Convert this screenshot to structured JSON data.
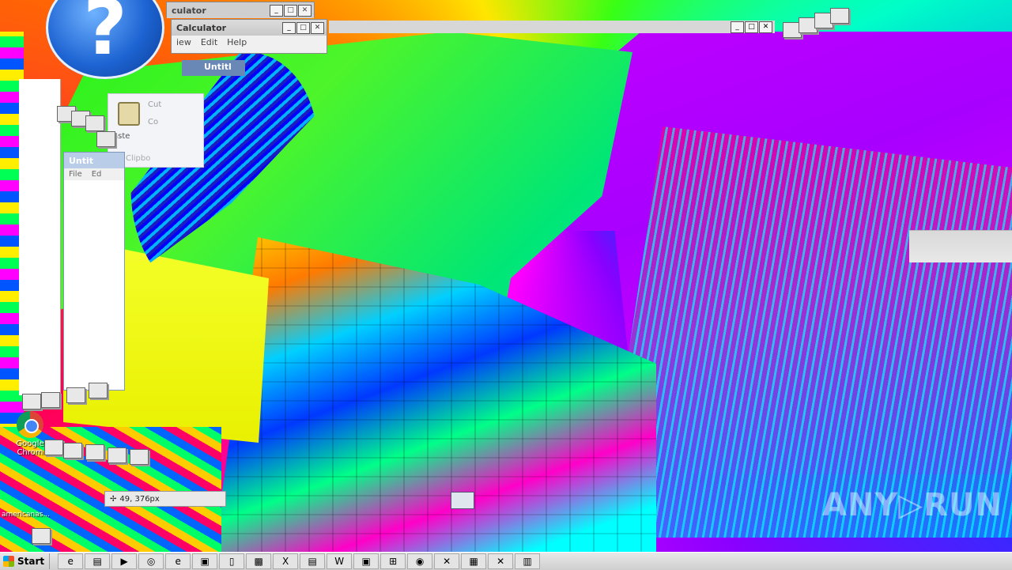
{
  "windows": {
    "calculator_back": {
      "title": "Calculator",
      "visible_title": "culator"
    },
    "calculator_front": {
      "title": "Calculator",
      "menu": [
        "View",
        "Edit",
        "Help"
      ],
      "visible_menu_first": "iew"
    },
    "untitled_top": {
      "title": "Untitled",
      "visible_title": "Untitl"
    },
    "untitled_left": {
      "title": "Untitled",
      "visible_title": "Untit",
      "menu": [
        "File",
        "Edit"
      ],
      "visible_menu_second": "Ed"
    },
    "window_buttons": {
      "minimize": "_",
      "maximize": "□",
      "close": "✕"
    }
  },
  "ribbon": {
    "paste_label": "Paste",
    "visible_paste": "aste",
    "cut_label": "Cut",
    "visible_cut": "Cut",
    "copy_label": "Copy",
    "visible_copy": "Co",
    "clipboard_group": "Clipboard",
    "visible_clipboard": "Clipbo"
  },
  "help_icon": {
    "glyph": "?"
  },
  "desktop": {
    "icons": [
      {
        "label": "Google Chrome",
        "line1": "Google",
        "line2": "Chrom"
      }
    ],
    "stray_label": "americanas..."
  },
  "cursor_tooltip": {
    "icon": "move-cursor-icon",
    "glyph": "✢",
    "text": "49, 376px"
  },
  "watermark": {
    "text": "ANY▷RUN"
  },
  "taskbar": {
    "start_label": "Start",
    "items": [
      {
        "name": "ie-icon",
        "glyph": "e"
      },
      {
        "name": "folder-icon",
        "glyph": "▤"
      },
      {
        "name": "media-player-icon",
        "glyph": "▶"
      },
      {
        "name": "chrome-icon",
        "glyph": "◎"
      },
      {
        "name": "edge-icon",
        "glyph": "e"
      },
      {
        "name": "app-red-icon",
        "glyph": "▣"
      },
      {
        "name": "notepad-icon",
        "glyph": "▯"
      },
      {
        "name": "green-app-icon",
        "glyph": "▩"
      },
      {
        "name": "excel-icon",
        "glyph": "X"
      },
      {
        "name": "document-icon",
        "glyph": "▤"
      },
      {
        "name": "word-icon",
        "glyph": "W"
      },
      {
        "name": "monitor-icon",
        "glyph": "▣"
      },
      {
        "name": "windows-icon",
        "glyph": "⊞"
      },
      {
        "name": "paint-icon",
        "glyph": "◉"
      },
      {
        "name": "error-icon",
        "glyph": "✕"
      },
      {
        "name": "toolbox-icon",
        "glyph": "▦"
      },
      {
        "name": "error-icon-2",
        "glyph": "✕"
      },
      {
        "name": "archive-icon",
        "glyph": "▥"
      }
    ]
  }
}
